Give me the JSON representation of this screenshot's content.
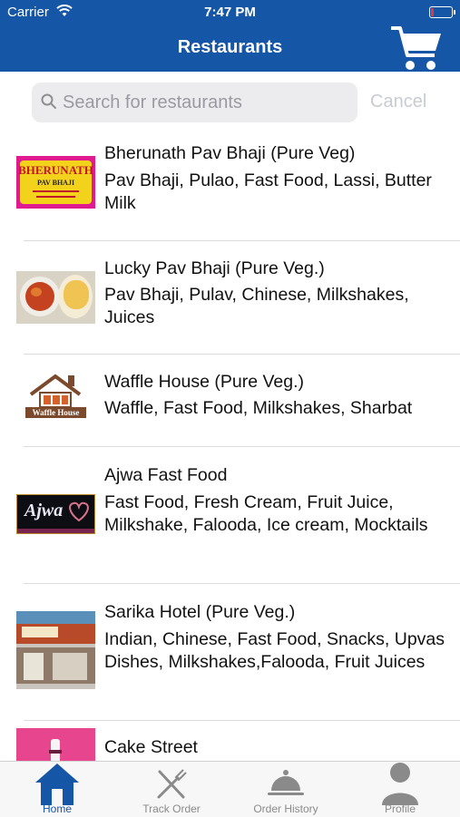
{
  "status_bar": {
    "carrier": "Carrier",
    "time": "7:47 PM",
    "battery_level": 0.15
  },
  "header": {
    "title": "Restaurants",
    "cart_icon": "shopping-cart-icon"
  },
  "search": {
    "placeholder": "Search for restaurants",
    "value": "",
    "cancel_label": "Cancel"
  },
  "restaurants": [
    {
      "name": "Bherunath Pav Bhaji (Pure Veg)",
      "cuisines": "Pav Bhaji, Pulao, Fast Food, Lassi, Butter Milk",
      "logo_text": "BHERUNATH",
      "logo_subtext": "PAV BHAJI"
    },
    {
      "name": "Lucky Pav Bhaji (Pure Veg.)",
      "cuisines": "Pav Bhaji, Pulav, Chinese, Milkshakes, Juices"
    },
    {
      "name": "Waffle House (Pure Veg.)",
      "cuisines": "Waffle, Fast Food, Milkshakes, Sharbat",
      "logo_text": "Waffle House"
    },
    {
      "name": "Ajwa Fast Food",
      "cuisines": "Fast Food, Fresh Cream, Fruit Juice, Milkshake, Falooda, Ice cream, Mocktails",
      "logo_text": "Ajwa"
    },
    {
      "name": "Sarika Hotel (Pure Veg.)",
      "cuisines": "Indian, Chinese, Fast Food, Snacks, Upvas Dishes, Milkshakes,Falooda, Fruit Juices"
    },
    {
      "name": "Cake Street",
      "cuisines": ""
    }
  ],
  "tabs": [
    {
      "label": "Home",
      "icon": "home-icon",
      "active": true
    },
    {
      "label": "Track Order",
      "icon": "fork-knife-icon",
      "active": false
    },
    {
      "label": "Order History",
      "icon": "food-cloche-icon",
      "active": false
    },
    {
      "label": "Profile",
      "icon": "person-icon",
      "active": false
    }
  ],
  "colors": {
    "brand": "#1556a6",
    "tab_inactive": "#8a8a8a",
    "cancel_text": "#c9cbd3"
  }
}
